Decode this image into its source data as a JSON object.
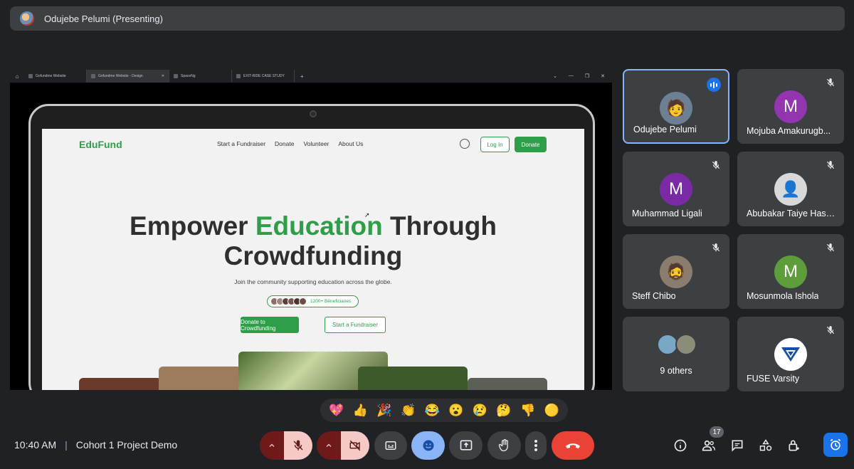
{
  "header": {
    "presenter_title": "Odujebe Pelumi (Presenting)"
  },
  "browser": {
    "tabs": [
      {
        "label": "Gofundme Website"
      },
      {
        "label": "Gofundme Website - Design"
      },
      {
        "label": "SpaceNg"
      },
      {
        "label": "EXIT-RIDE CASE STUDY"
      }
    ],
    "active_tab_index": 1
  },
  "site": {
    "logo": "EduFund",
    "nav": [
      "Start a Fundraiser",
      "Donate",
      "Volunteer",
      "About Us"
    ],
    "login_label": "Log In",
    "donate_label": "Donate",
    "hero_part1": "Empower ",
    "hero_green": "Education",
    "hero_part2": " Through",
    "hero_line2": "Crowdfunding",
    "subtitle": "Join the community supporting education across the globe.",
    "beneficiaries": "1200+ Beneficiaries",
    "cta_primary": "Donate to Crowdfunding",
    "cta_secondary": "Start a Fundraiser",
    "brand_color": "#2e9e48"
  },
  "participants": [
    {
      "name": "Odujebe Pelumi",
      "initial": "",
      "color": "#6d7f93",
      "speaking": true,
      "muted": false
    },
    {
      "name": "Mojuba Amakurugb...",
      "initial": "M",
      "color": "#9334b0",
      "muted": true
    },
    {
      "name": "Muhammad Ligali",
      "initial": "M",
      "color": "#7b2aa6",
      "muted": true
    },
    {
      "name": "Abubakar Taiye Hass...",
      "initial": "",
      "color": "#d9d9d9",
      "muted": true
    },
    {
      "name": "Steff Chibo",
      "initial": "",
      "color": "#8a7d6d",
      "muted": true
    },
    {
      "name": "Mosunmola Ishola",
      "initial": "M",
      "color": "#5d9e3a",
      "muted": true
    },
    {
      "name": "9 others",
      "initial": "",
      "color": "",
      "muted": false
    },
    {
      "name": "FUSE Varsity",
      "initial": "",
      "color": "#ffffff",
      "muted": true
    }
  ],
  "reactions": [
    "💖",
    "👍",
    "🎉",
    "👏",
    "😂",
    "😮",
    "😢",
    "🤔",
    "👎",
    "🟡"
  ],
  "footer": {
    "time": "10:40 AM",
    "separator": "|",
    "meeting_name": "Cohort 1 Project Demo",
    "participant_count": "17"
  }
}
